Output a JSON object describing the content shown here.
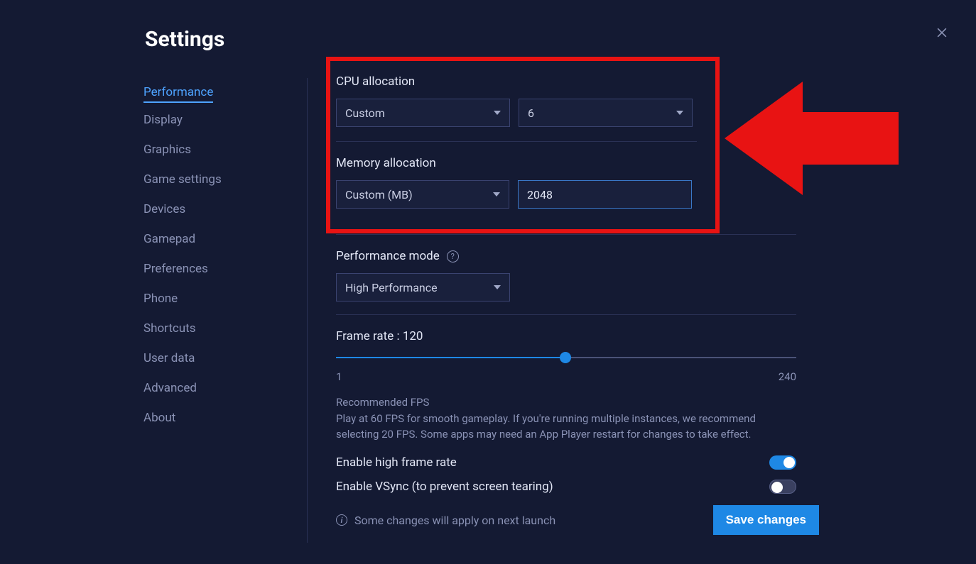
{
  "title": "Settings",
  "sidebar": {
    "items": [
      {
        "label": "Performance",
        "active": true
      },
      {
        "label": "Display"
      },
      {
        "label": "Graphics"
      },
      {
        "label": "Game settings"
      },
      {
        "label": "Devices"
      },
      {
        "label": "Gamepad"
      },
      {
        "label": "Preferences"
      },
      {
        "label": "Phone"
      },
      {
        "label": "Shortcuts"
      },
      {
        "label": "User data"
      },
      {
        "label": "Advanced"
      },
      {
        "label": "About"
      }
    ]
  },
  "cpu": {
    "label": "CPU allocation",
    "mode": "Custom",
    "value": "6"
  },
  "memory": {
    "label": "Memory allocation",
    "mode": "Custom (MB)",
    "value": "2048"
  },
  "perf_mode": {
    "label": "Performance mode",
    "value": "High Performance"
  },
  "frame_rate": {
    "label_prefix": "Frame rate : ",
    "value": 120,
    "min": 1,
    "max": 240,
    "rec_title": "Recommended FPS",
    "rec_body": "Play at 60 FPS for smooth gameplay. If you're running multiple instances, we recommend selecting 20 FPS. Some apps may need an App Player restart for changes to take effect."
  },
  "toggles": {
    "high_frame": {
      "label": "Enable high frame rate",
      "on": true
    },
    "vsync": {
      "label": "Enable VSync (to prevent screen tearing)",
      "on": false
    }
  },
  "footer": {
    "note": "Some changes will apply on next launch",
    "save": "Save changes"
  },
  "annotation": {
    "arrow_color": "#e81313"
  }
}
